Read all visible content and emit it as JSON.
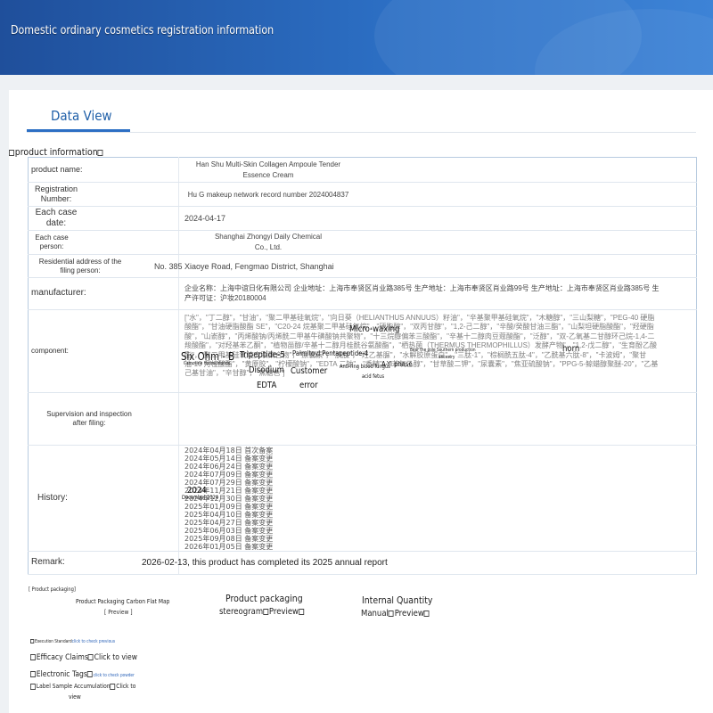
{
  "banner": {
    "title": "Domestic ordinary cosmetics registration information"
  },
  "tab": {
    "label": "Data View"
  },
  "section": {
    "title": "product information"
  },
  "rows": {
    "product_name": {
      "label": "product name:",
      "value_line1": "Han Shu Multi-Skin Collagen Ampoule Tender",
      "value_line2": "Essence Cream"
    },
    "registration": {
      "label_line1": "Registration",
      "label_line2": "Number:",
      "value": "Hu G makeup network record number 2024004837"
    },
    "case_date": {
      "label_line1": "Each case",
      "label_line2": "date:",
      "value": "2024-04-17"
    },
    "case_person": {
      "label_line1": "Each case",
      "label_line2": "person:",
      "value_line1": "Shanghai Zhongyi Daily Chemical",
      "value_line2": "Co., Ltd."
    },
    "residential": {
      "label_line1": "Residential address of the",
      "label_line2": "filing person:",
      "value": "No. 385 Xiaoye Road, Fengmao District, Shanghai"
    },
    "manufacturer": {
      "label": "manufacturer:",
      "value": "企业名称：上海中谊日化有限公司 企业地址：上海市奉贤区肖业路385号 生产地址：上海市奉贤区肖业路99号 生产地址：上海市奉贤区肖业路385号 生产许可证：沪妆20180004"
    },
    "component": {
      "label": "component:",
      "value": "[\"水\"，\"丁二醇\"，\"甘油\"，\"聚二甲基硅氧烷\"，\"向日葵（HELIANTHUS ANNUUS）籽油\"，\"辛基聚甲基硅氧烷\"，\"木糖醇\"，\"三山梨糖\"，\"PEG-40 硬脂酸酯\"，\"甘油硬脂酸酯 SE\"，\"C20-24 烷基聚二甲基硅氧烷\"，\"硬脂醇\"，\"双丙甘醇\"，\"1,2-己二醇\"，\"辛酸/癸酸甘油三酯\"，\"山梨坦硬脂酸酯\"，\"羟硬脂酸\"，\"山嵛醇\"，\"丙烯酸钠/丙烯酰二甲基牛磺酸钠共聚物\"，\"十三烷醇偏苯三酸酯\"，\"辛基十二醇肉豆蔻酸酯\"，\"泛醇\"，\"双-乙氧基二甘醇环己烷-1,4-二羧酸酯\"，\"对羟基苯乙酮\"，\"植物甾醇/辛基十二醇月桂酰谷氨酸酯\"，\"栖热菌（THERMUS THERMOPHILLUS）发酵产物\"，\"1,2-戊二醇\"，\"生育酚乙酸酯\"，\"聚二甲基硅氧烷交联聚合物\"，\"尿囊素\"，\"肌肽\"，\"羟乙基脲\"，\"水解胶原蛋白\"，\"三肽-1\"，\"棕榈酰五肽-4\"，\"乙酰基六肽-8\"，\"卡波姆\"，\"聚甘油-10 月桂酸酯\"，\"黄原胶\"，\"柠檬酸钠\"，\"EDTA 二钠\"，\"香精\"，\"苯氧乙醇\"，\"甘草酸二钾\"，\"尿囊素\"，\"焦亚硫酸钠\"，\"PPG-5-鲸蜡醇聚醚-20\"，\"乙基己基甘油\"，\"辛甘醇\"，\"焦糖色\"]"
    },
    "supervision": {
      "label_line1": "Supervision and inspection",
      "label_line2": "after filing:",
      "value": ""
    },
    "history": {
      "label": "History:",
      "entries": [
        "2024年04月18日 首次备案",
        "2024年05月14日 备案变更",
        "2024年06月24日 备案变更",
        "2024年07月09日 备案变更",
        "2024年07月29日 备案变更",
        "2024年11月21日 备案变更",
        "2024年12月30日 备案变更",
        "2025年01月09日 备案变更",
        "2025年04月10日 备案变更",
        "2025年04月27日 备案变更",
        "2025年06月03日 备案变更",
        "2025年09月08日 备案变更",
        "2026年01月05日 备案变更"
      ]
    },
    "remark": {
      "label": "Remark:",
      "value": "2026-02-13, this product has completed its 2025 annual report"
    }
  },
  "overlays": {
    "micro_waxing": "Micro-waxing",
    "six_ohm": "Six Ohm - B",
    "tripeptide5": "Tripeptide-5",
    "palmitoyl": "Palmitoyl Pentapeptide-4",
    "horn": "horn",
    "bear_pole": "Bear the pole Southern production",
    "ancestry": "ancestry",
    "carnosine": "Carnosine Hydrochloride",
    "disodium": "Disodium",
    "edta": "EDTA",
    "customer": "Customer",
    "error": "error",
    "anti_ring": "Anti-ring blood fungus",
    "a_yi": "A-Yi phase",
    "acid_fetus": "acid fetus",
    "year_2024": "2024",
    "december_2024": "December 2024"
  },
  "bottom": {
    "product_packaging_tag": "[ Product packaging]",
    "flat_map": "Product Packaging Carbon Flat Map",
    "flat_map_preview": "[ Preview ]",
    "stereogram_line1": "Product packaging",
    "stereogram_line2": "stereogram",
    "stereogram_preview": "Preview",
    "manual_line1": "Internal Quantity",
    "manual_line2": "Manual",
    "manual_preview": "Preview",
    "execution_label": "Execution Standard",
    "execution_link": "click to check previous",
    "efficacy_label": "Efficacy Claims",
    "efficacy_link": "Click to view",
    "electronic_label": "Electronic Tags",
    "electronic_link": "click to check powder",
    "sample_label": "Label Sample Accumulation",
    "sample_link_line1": "Click to",
    "sample_link_line2": "view"
  }
}
